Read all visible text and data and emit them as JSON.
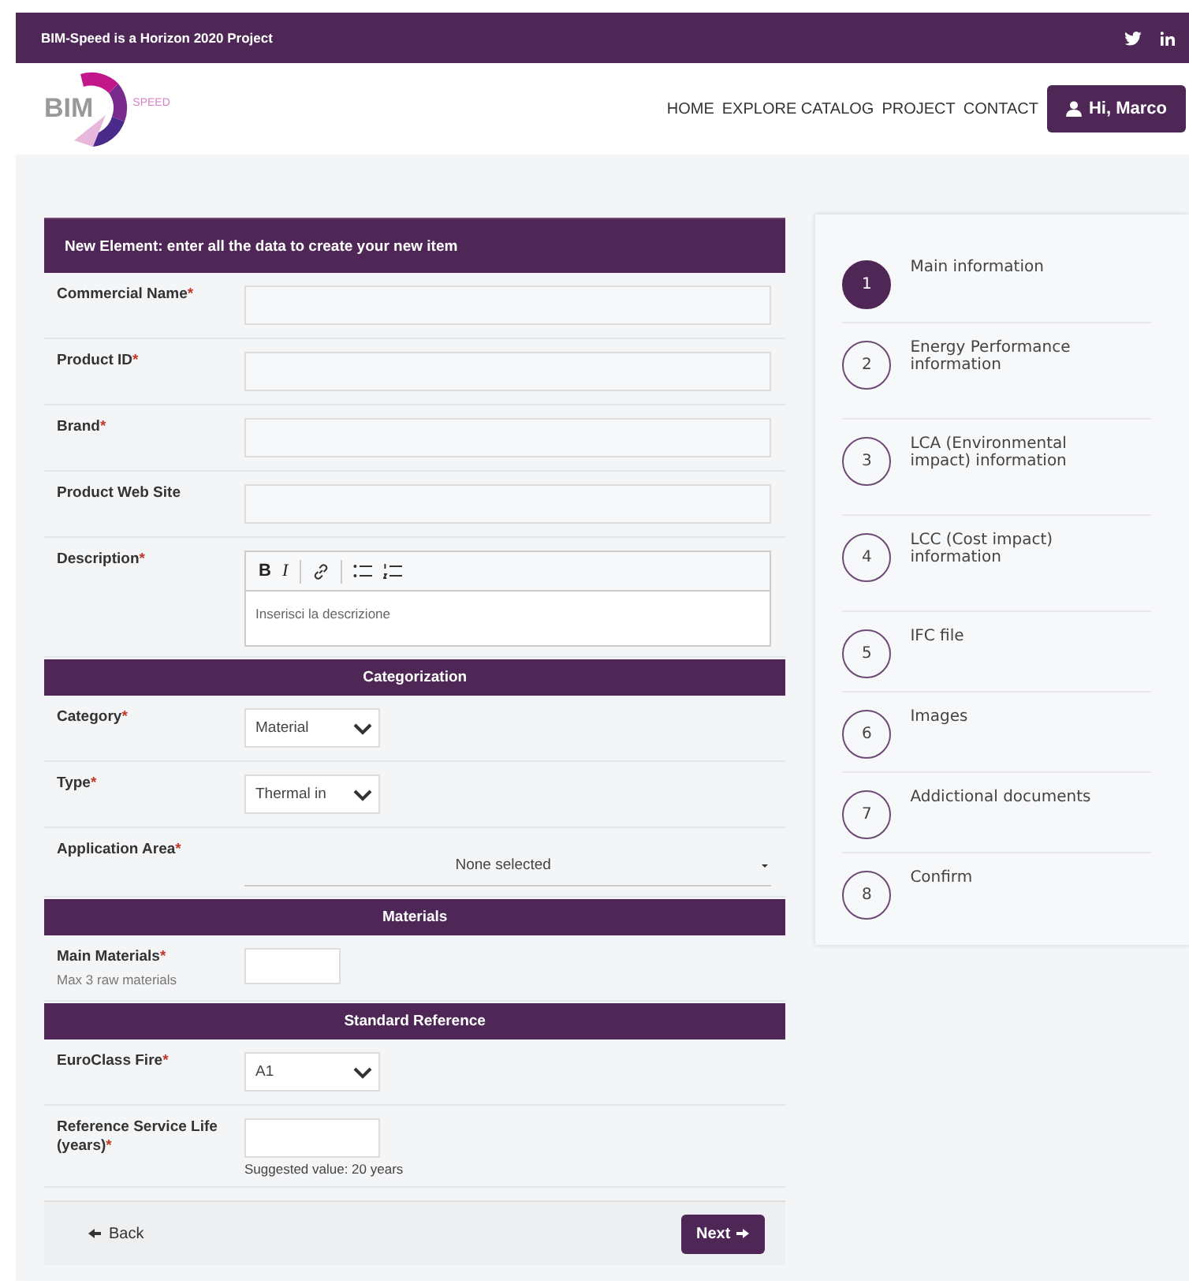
{
  "topbar": {
    "text": "BIM-Speed is a Horizon 2020 Project"
  },
  "logo": {
    "main": "BIM",
    "sub": "SPEED"
  },
  "nav": [
    {
      "label": "HOME"
    },
    {
      "label": "EXPLORE CATALOG"
    },
    {
      "label": "PROJECT"
    },
    {
      "label": "CONTACT"
    }
  ],
  "user_button": {
    "label": "Hi, Marco"
  },
  "form": {
    "title": "New Element: enter all the data to create your new item",
    "blocks": [
      {
        "kind": "field",
        "label": "Commercial Name",
        "mark": "*",
        "control": {
          "kind": "text"
        }
      },
      {
        "kind": "field",
        "label": "Product ID",
        "mark": "*",
        "control": {
          "kind": "text"
        }
      },
      {
        "kind": "field",
        "label": "Brand",
        "mark": "*",
        "control": {
          "kind": "text"
        }
      },
      {
        "kind": "field",
        "label": "Product Web Site",
        "control": {
          "kind": "text"
        }
      },
      {
        "kind": "field",
        "label": "Description",
        "mark": "*",
        "control": {
          "kind": "editor",
          "tools": [
            "B",
            "I"
          ],
          "placeholder": "Inserisci la descrizione"
        }
      },
      {
        "kind": "section",
        "title": "Categorization"
      },
      {
        "kind": "field",
        "label": "Category",
        "mark": "*",
        "control": {
          "kind": "select",
          "value": "Material"
        }
      },
      {
        "kind": "field",
        "label": "Type",
        "mark": "*",
        "control": {
          "kind": "select",
          "value": "Thermal in"
        }
      },
      {
        "kind": "field",
        "label": "Application Area",
        "mark": "*",
        "control": {
          "kind": "multiselect",
          "value": "None selected"
        }
      },
      {
        "kind": "section",
        "title": "Materials"
      },
      {
        "kind": "field",
        "label": "Main Materials",
        "mark": "*",
        "hint": "Max 3 raw materials",
        "control": {
          "kind": "small"
        }
      },
      {
        "kind": "section",
        "title": "Standard Reference"
      },
      {
        "kind": "field",
        "label": "EuroClass Fire",
        "mark": "*",
        "control": {
          "kind": "select",
          "value": "A1"
        }
      },
      {
        "kind": "field",
        "label": "Reference Service Life (years)",
        "mark": "*",
        "control": {
          "kind": "short",
          "help": "Suggested value: 20 years"
        }
      }
    ],
    "back": {
      "label": "Back"
    },
    "next": {
      "label": "Next"
    }
  },
  "steps": [
    {
      "number": "1",
      "label": "Main information",
      "selected": true
    },
    {
      "number": "2",
      "label": "Energy Performance information",
      "selected": false
    },
    {
      "number": "3",
      "label": "LCA (Environmental impact) information",
      "selected": false
    },
    {
      "number": "4",
      "label": "LCC (Cost impact) information",
      "selected": false
    },
    {
      "number": "5",
      "label": "IFC file",
      "selected": false
    },
    {
      "number": "6",
      "label": "Images",
      "selected": false
    },
    {
      "number": "7",
      "label": "Addictional documents",
      "selected": false
    },
    {
      "number": "8",
      "label": "Confirm",
      "selected": false
    }
  ]
}
